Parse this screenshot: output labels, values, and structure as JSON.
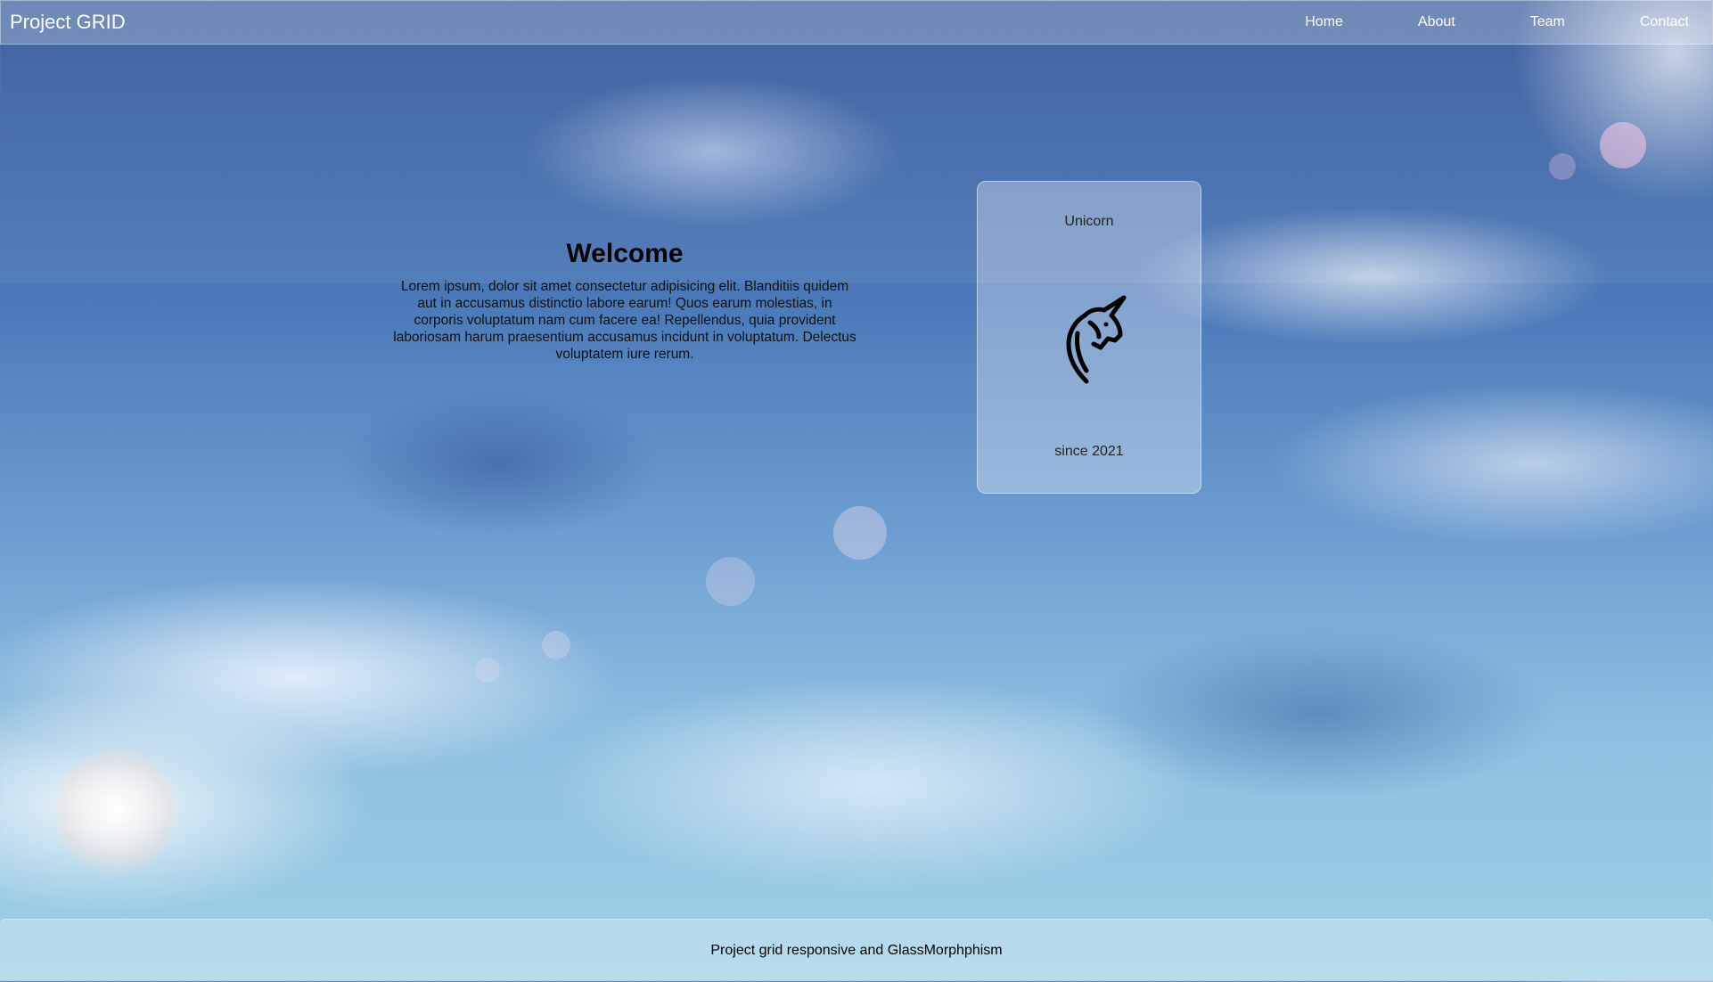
{
  "navbar": {
    "brand": "Project GRID",
    "links": [
      {
        "label": "Home"
      },
      {
        "label": "About"
      },
      {
        "label": "Team"
      },
      {
        "label": "Contact"
      }
    ]
  },
  "welcome": {
    "title": "Welcome",
    "body": "Lorem ipsum, dolor sit amet consectetur adipisicing elit. Blanditiis quidem aut in accusamus distinctio labore earum! Quos earum molestias, in corporis voluptatum nam cum facere ea! Repellendus, quia provident laboriosam harum praesentium accusamus incidunt in voluptatum. Delectus voluptatem iure rerum."
  },
  "card": {
    "title": "Unicorn",
    "logo_icon": "unicorn-icon",
    "subtitle": "since 2021"
  },
  "footer": {
    "text": "Project grid responsive and GlassMorphphism"
  }
}
